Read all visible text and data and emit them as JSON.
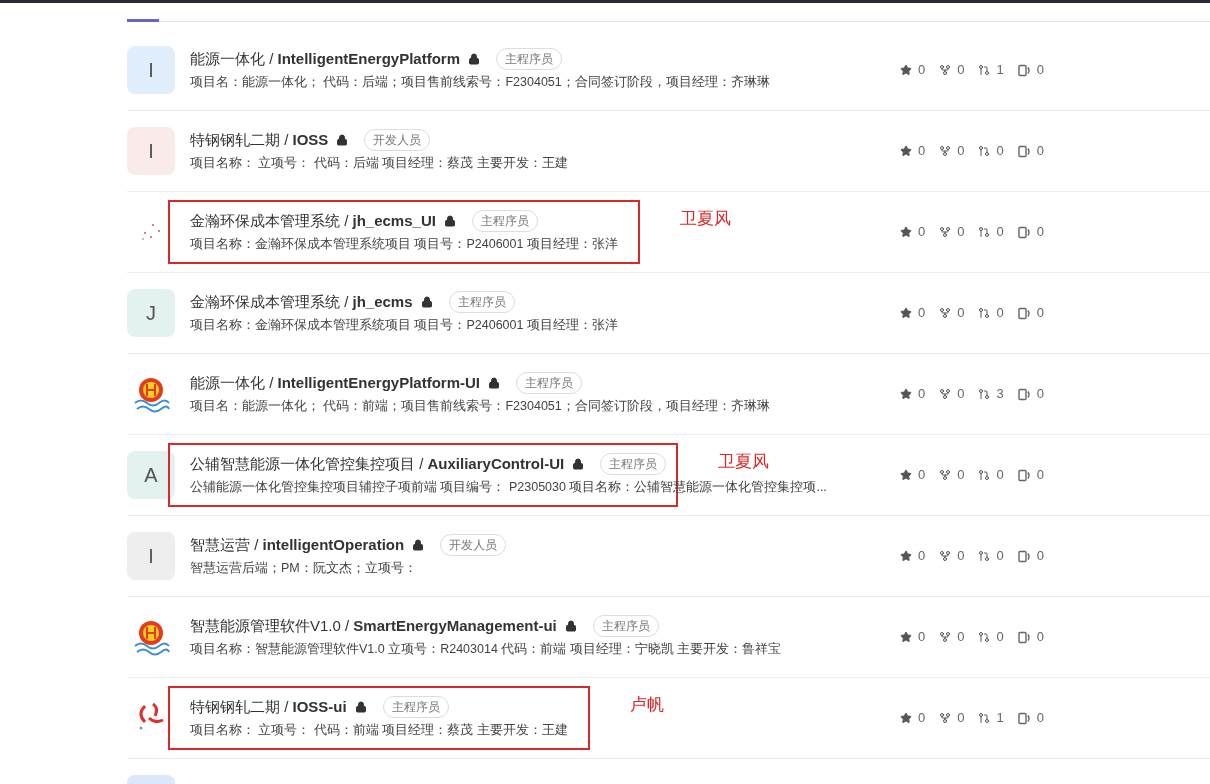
{
  "projects": [
    {
      "avatar": {
        "kind": "letter",
        "letter": "I",
        "color": "#e1eefc"
      },
      "title": "能源一体化 / **IntelligentEnergyPlatform**",
      "private": true,
      "role": "主程序员",
      "description": "项目名：能源一体化； 代码：后端；项目售前线索号：F2304051；合同签订阶段，项目经理：齐琳琳",
      "stars": "0",
      "forks": "0",
      "merge_requests": "1",
      "issues": "0"
    },
    {
      "avatar": {
        "kind": "letter",
        "letter": "I",
        "color": "#fbeaea"
      },
      "title": "特钢钢轧二期 / **IOSS**",
      "private": true,
      "role": "开发人员",
      "description": "项目名称： 立项号： 代码：后端 项目经理：蔡茂 主要开发：王建",
      "stars": "0",
      "forks": "0",
      "merge_requests": "0",
      "issues": "0"
    },
    {
      "avatar": {
        "kind": "dots"
      },
      "title": "金瀚环保成本管理系统 / **jh_ecms_UI**",
      "private": true,
      "role": "主程序员",
      "description": "项目名称：金瀚环保成本管理系统项目 项目号：P2406001 项目经理：张洋",
      "stars": "0",
      "forks": "0",
      "merge_requests": "0",
      "issues": "0",
      "annotation": "卫夏风"
    },
    {
      "avatar": {
        "kind": "letter",
        "letter": "J",
        "color": "#e3f2f0"
      },
      "title": "金瀚环保成本管理系统 / **jh_ecms**",
      "private": true,
      "role": "主程序员",
      "description": "项目名称：金瀚环保成本管理系统项目 项目号：P2406001 项目经理：张洋",
      "stars": "0",
      "forks": "0",
      "merge_requests": "0",
      "issues": "0"
    },
    {
      "avatar": {
        "kind": "sun-waves"
      },
      "title": "能源一体化 / **IntelligentEnergyPlatform-UI**",
      "private": true,
      "role": "主程序员",
      "description": "项目名：能源一体化； 代码：前端；项目售前线索号：F2304051；合同签订阶段，项目经理：齐琳琳",
      "stars": "0",
      "forks": "0",
      "merge_requests": "3",
      "issues": "0"
    },
    {
      "avatar": {
        "kind": "letter",
        "letter": "A",
        "color": "#e3f1f1"
      },
      "title": "公辅智慧能源一体化管控集控项目 / **AuxiliaryControl-UI**",
      "private": true,
      "role": "主程序员",
      "description": "公辅能源一体化管控集控项目辅控子项前端 项目编号： P2305030 项目名称：公辅智慧能源一体化管控集控项...",
      "stars": "0",
      "forks": "0",
      "merge_requests": "0",
      "issues": "0",
      "annotation": "卫夏风"
    },
    {
      "avatar": {
        "kind": "letter",
        "letter": "I",
        "color": "#eeeeee"
      },
      "title": "智慧运营 / **intelligentOperation**",
      "private": true,
      "role": "开发人员",
      "description": "智慧运营后端；PM：阮文杰；立项号：",
      "stars": "0",
      "forks": "0",
      "merge_requests": "0",
      "issues": "0"
    },
    {
      "avatar": {
        "kind": "sun-waves"
      },
      "title": "智慧能源管理软件V1.0 / **SmartEnergyManagement-ui**",
      "private": true,
      "role": "主程序员",
      "description": "项目名称：智慧能源管理软件V1.0 立项号：R2403014 代码：前端 项目经理：宁晓凯 主要开发：鲁祥宝",
      "stars": "0",
      "forks": "0",
      "merge_requests": "0",
      "issues": "0"
    },
    {
      "avatar": {
        "kind": "swirl"
      },
      "title": "特钢钢轧二期 / **IOSS-ui**",
      "private": true,
      "role": "主程序员",
      "description": "项目名称： 立项号： 代码：前端 项目经理：蔡茂 主要开发：王建",
      "stars": "0",
      "forks": "0",
      "merge_requests": "1",
      "issues": "0",
      "annotation": "卢帆"
    },
    {
      "avatar": {
        "kind": "letter",
        "color": "#dbe8fb"
      }
    }
  ]
}
